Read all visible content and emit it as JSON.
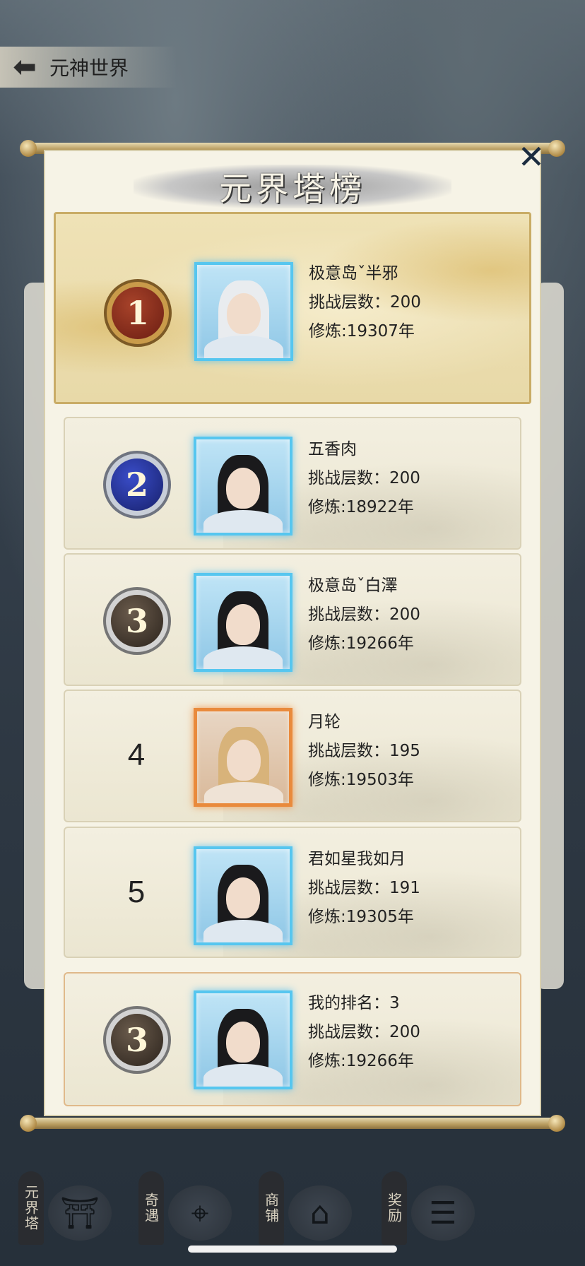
{
  "header": {
    "back_icon": "back-arrow-icon",
    "title": "元神世界"
  },
  "dialog": {
    "title": "元界塔榜",
    "close_icon": "close-x-icon",
    "rankings": [
      {
        "rank": "1",
        "name": "极意岛ˇ半邪",
        "floors_label": "挑战层数：200",
        "cultivation_label": "修炼:19307年"
      },
      {
        "rank": "2",
        "name": "五香肉",
        "floors_label": "挑战层数：200",
        "cultivation_label": "修炼:18922年"
      },
      {
        "rank": "3",
        "name": "极意岛ˇ白澤",
        "floors_label": "挑战层数：200",
        "cultivation_label": "修炼:19266年"
      },
      {
        "rank": "4",
        "name": "月轮",
        "floors_label": "挑战层数：195",
        "cultivation_label": "修炼:19503年"
      },
      {
        "rank": "5",
        "name": "君如星我如月",
        "floors_label": "挑战层数：191",
        "cultivation_label": "修炼:19305年"
      }
    ],
    "mine": {
      "rank": "3",
      "rank_label": "我的排名：3",
      "floors_label": "挑战层数：200",
      "cultivation_label": "修炼:19266年"
    }
  },
  "bottom_nav": [
    {
      "label": "元界塔",
      "icon": "pagoda-icon"
    },
    {
      "label": "奇遇",
      "icon": "map-pin-icon"
    },
    {
      "label": "商铺",
      "icon": "shop-icon"
    },
    {
      "label": "奖励",
      "icon": "reward-chest-icon"
    }
  ]
}
